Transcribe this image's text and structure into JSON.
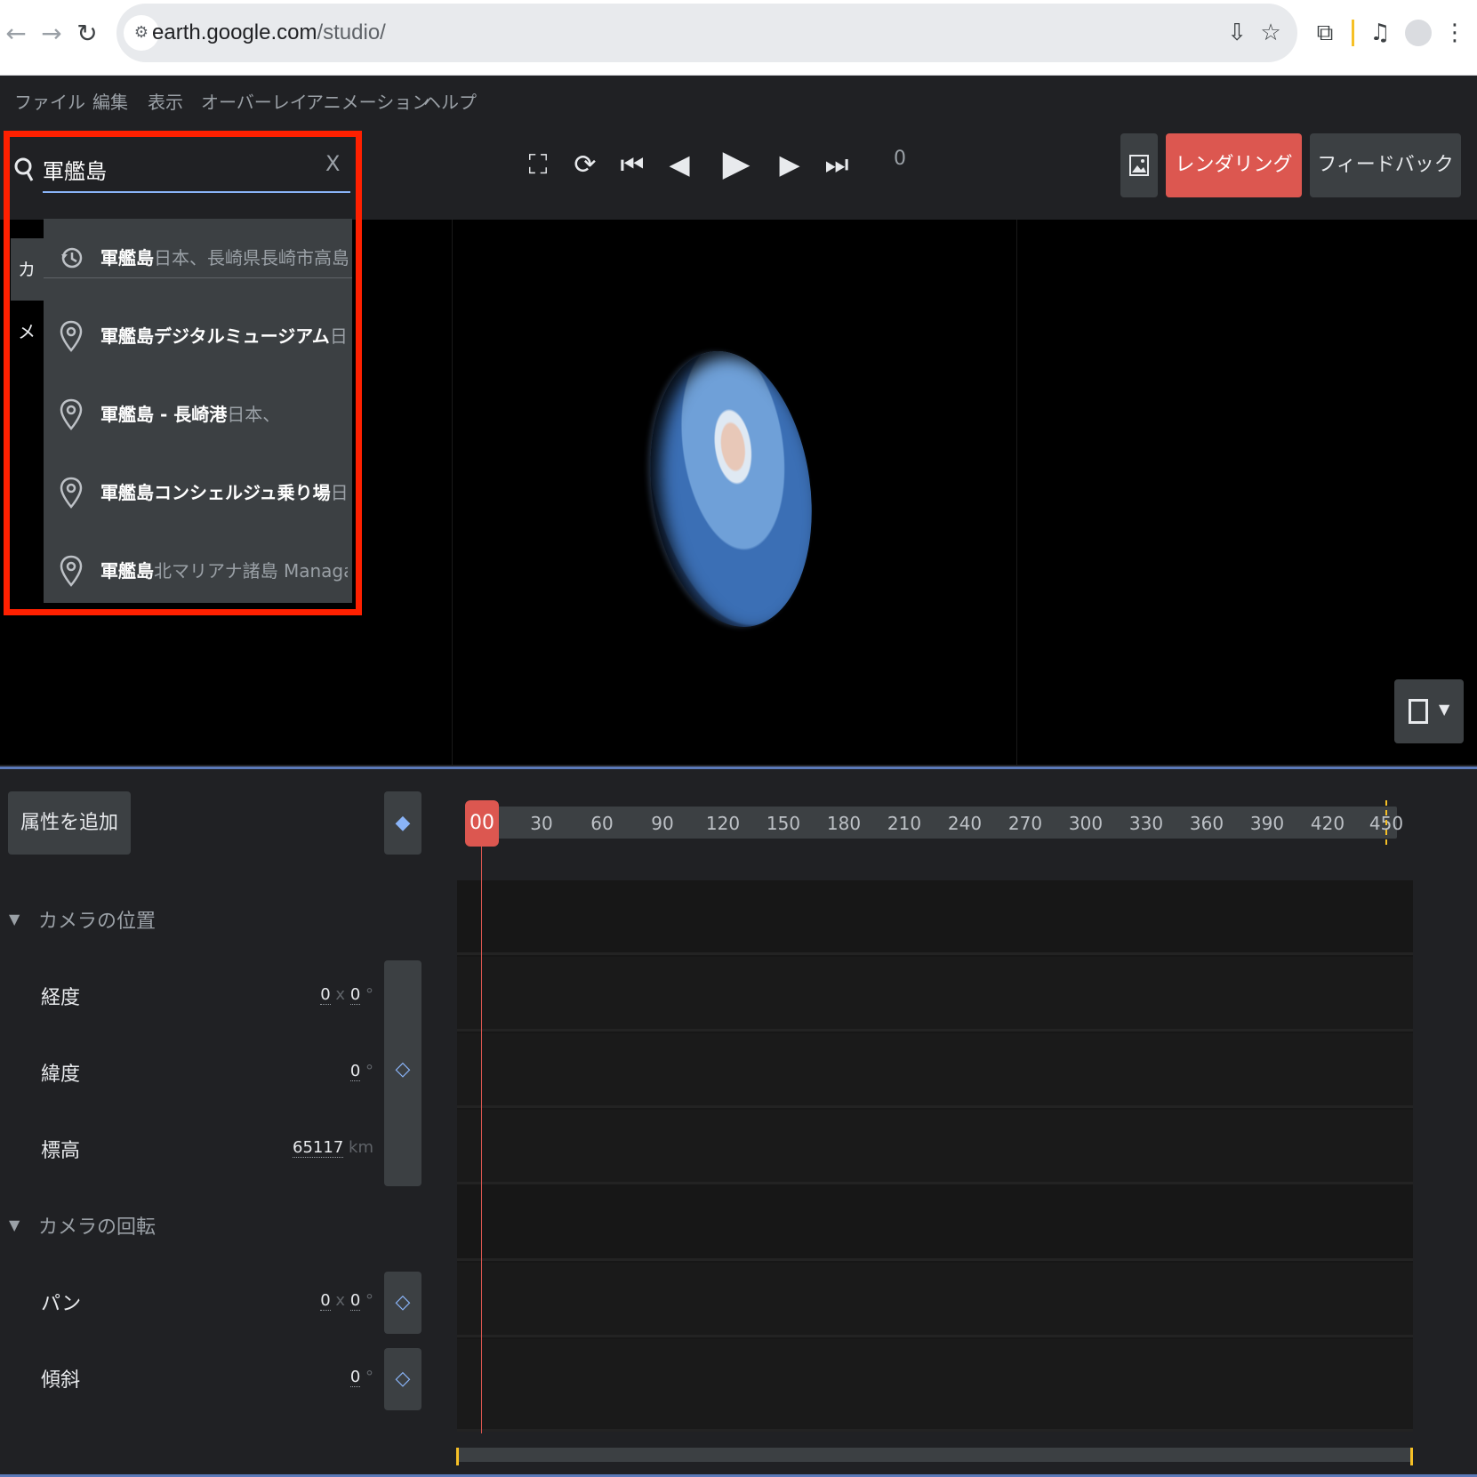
{
  "browser": {
    "url_host": "earth.google.com",
    "url_path": "/studio/"
  },
  "menu": [
    "ファイル",
    "編集",
    "表示",
    "オーバーレイ",
    "アニメーション",
    "ヘルプ"
  ],
  "toolbar": {
    "frame": "0",
    "render_label": "レンダリング",
    "feedback_label": "フィードバック"
  },
  "search": {
    "value": "軍艦島",
    "clear": "X",
    "results": [
      {
        "icon": "history-icon",
        "main": "軍艦島",
        "sub": "日本、長崎県長崎市高島町"
      },
      {
        "icon": "pin-icon",
        "main": "軍艦島デジタルミュージアム",
        "sub": "日本、長…"
      },
      {
        "icon": "pin-icon",
        "main": "軍艦島 - 長崎港",
        "sub": "日本、"
      },
      {
        "icon": "pin-icon",
        "main": "軍艦島コンシェルジュ乗り場",
        "sub": "日本、長…"
      },
      {
        "icon": "pin-icon",
        "main": "軍艦島",
        "sub": "北マリアナ諸島 Managaha,"
      }
    ]
  },
  "viewport": {
    "camera_tab": "カメ"
  },
  "timeline": {
    "add_attribute": "属性を追加",
    "playhead": "00",
    "ticks": [
      "30",
      "60",
      "90",
      "120",
      "150",
      "180",
      "210",
      "240",
      "270",
      "300",
      "330",
      "360",
      "390",
      "420",
      "450"
    ],
    "sections": [
      {
        "title": "カメラの位置",
        "props": [
          {
            "label": "経度",
            "v1": "0",
            "sep": "x",
            "v2": "0",
            "unit": "°"
          },
          {
            "label": "緯度",
            "v1": "",
            "sep": "",
            "v2": "0",
            "unit": "°"
          },
          {
            "label": "標高",
            "v1": "",
            "sep": "",
            "v2": "65117",
            "unit": "km"
          }
        ]
      },
      {
        "title": "カメラの回転",
        "props": [
          {
            "label": "パン",
            "v1": "0",
            "sep": "x",
            "v2": "0",
            "unit": "°"
          },
          {
            "label": "傾斜",
            "v1": "",
            "sep": "",
            "v2": "0",
            "unit": "°"
          }
        ]
      }
    ]
  },
  "colors": {
    "accent_red": "#dc5750",
    "highlight_box": "#ff2000",
    "keyframe_blue": "#8ab4f8"
  }
}
